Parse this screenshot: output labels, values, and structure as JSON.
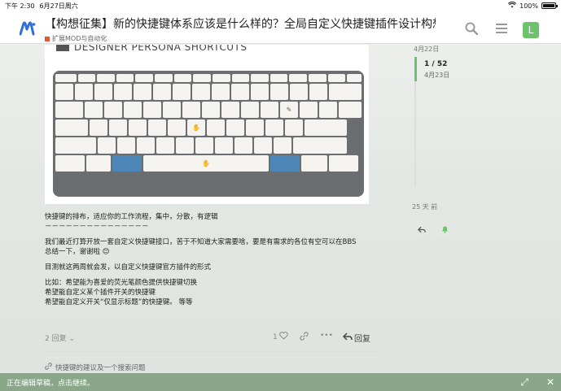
{
  "status_bar": {
    "time": "下午 2:30",
    "date": "6月27日周六",
    "battery": "100%"
  },
  "header": {
    "title": "【构想征集】新的快捷键体系应该是什么样的？全局自定义快捷键插件设计构想",
    "category": "扩展MOD与自动化",
    "avatar_letter": "L",
    "icons": [
      "search-icon",
      "menu-icon"
    ]
  },
  "post": {
    "image_caption": "DESIGNER PERSONA SHORTCUTS",
    "paragraphs": [
      [
        "快捷键的排布，适应你的工作流程，集中，分散，有逻辑",
        "－－－－－－－－－－－－－－－"
      ],
      [
        "我们最近打算开放一套自定义快捷键接口，苦于不知道大家需要啥，要是有需求的各位有空可以在BBS",
        "总结一下，谢谢啦 😊"
      ],
      [
        "目测就这两周就会发，以自定义快捷键官方插件的形式"
      ],
      [
        "比如：希望能为喜爱的荧光笔颜色提供快捷键切换",
        "希望能自定义某个插件开关的快捷键",
        "希望能自定义开关“仅显示标题”的快捷键。 等等"
      ]
    ],
    "replies": "2 回复",
    "like_count": "1",
    "reply_label": "回复"
  },
  "related_topic": "快捷键的建议及一个搜索问题",
  "timeline": {
    "top_date": "4月22日",
    "position": "1 / 52",
    "position_date": "4月23日",
    "bottom_ago": "25 天 前"
  },
  "draft_bar": {
    "text": "正在编辑草稿，点击继续。"
  },
  "colors": {
    "accent_green": "#6cc36c",
    "category_red": "#e45735",
    "draft_bar": "#8aa78a",
    "key_blue": "#4f86b8"
  }
}
